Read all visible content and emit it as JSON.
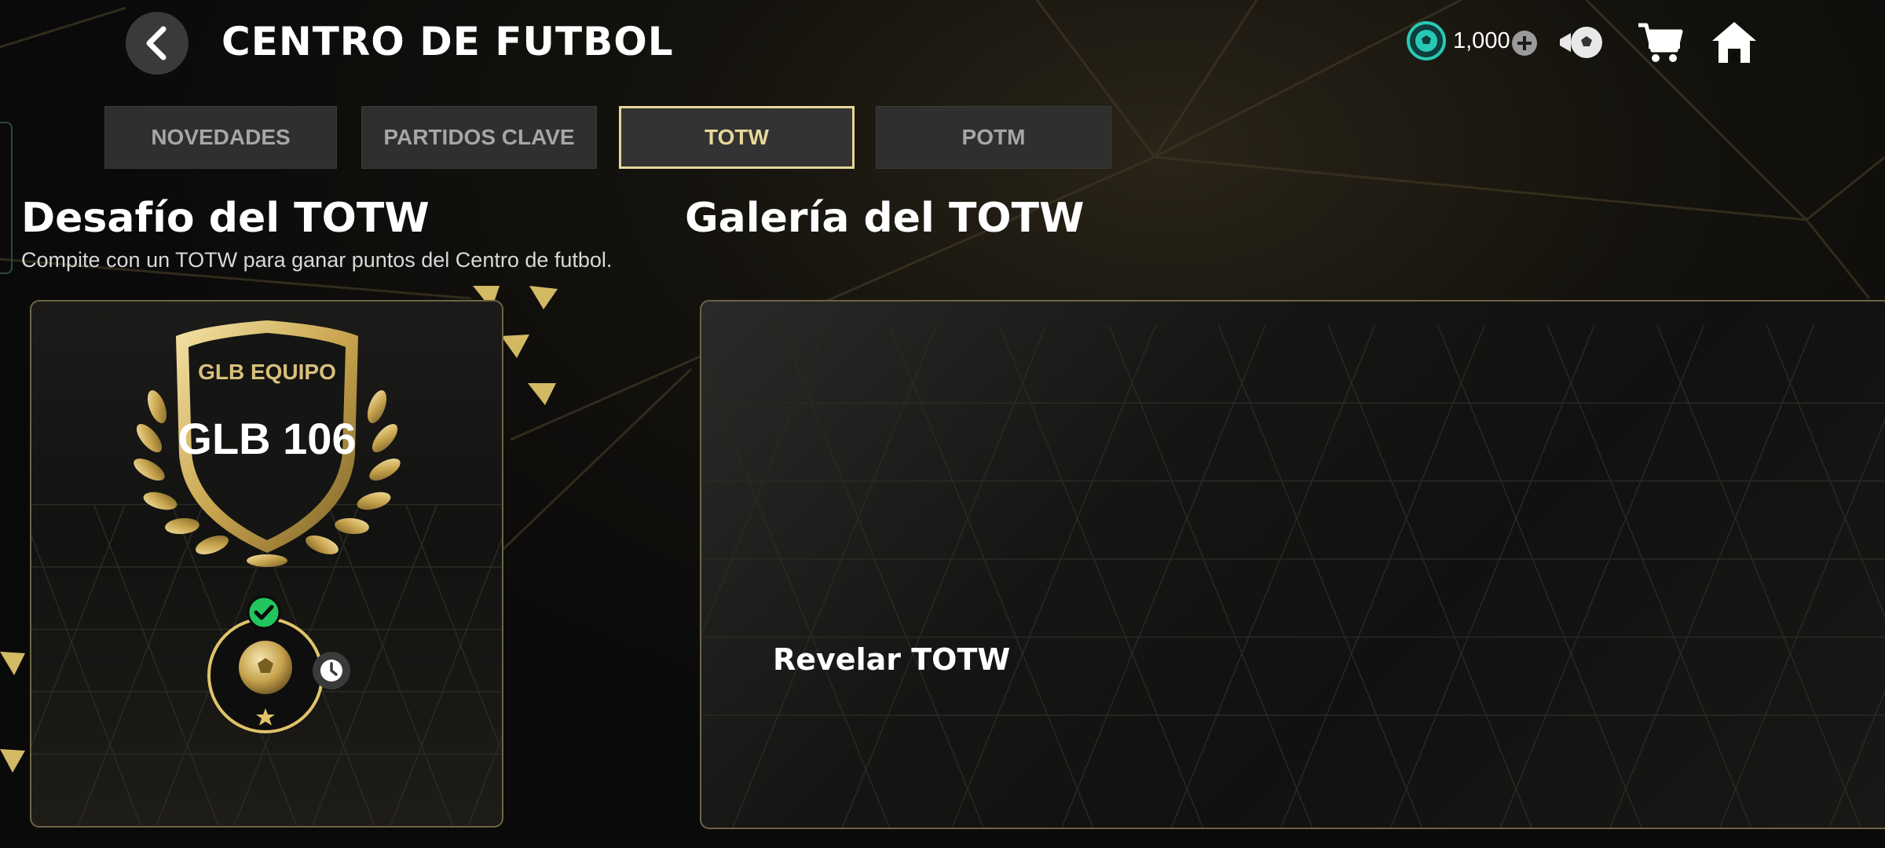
{
  "header": {
    "title": "CENTRO DE FUTBOL",
    "currency_amount": "1,000"
  },
  "tabs": [
    {
      "label": "NOVEDADES",
      "active": false
    },
    {
      "label": "PARTIDOS CLAVE",
      "active": false
    },
    {
      "label": "TOTW",
      "active": true
    },
    {
      "label": "POTM",
      "active": false
    }
  ],
  "challenge": {
    "title": "Desafío del TOTW",
    "subtitle": "Compite con un TOTW para ganar puntos del Centro de futbol.",
    "emblem_top": "GLB EQUIPO",
    "emblem_main": "GLB 106"
  },
  "gallery": {
    "title": "Galería del TOTW",
    "reveal_label": "Revelar TOTW"
  },
  "colors": {
    "gold": "#e0c46a",
    "active_tab_border": "#e6d79a",
    "currency_teal": "#28c9b4",
    "check_green": "#22c55e"
  },
  "icons": {
    "back": "chevron-left-icon",
    "currency": "football-coin-icon",
    "add": "plus-circle-icon",
    "packs": "football-packs-icon",
    "store": "shopping-cart-icon",
    "home": "home-icon"
  }
}
